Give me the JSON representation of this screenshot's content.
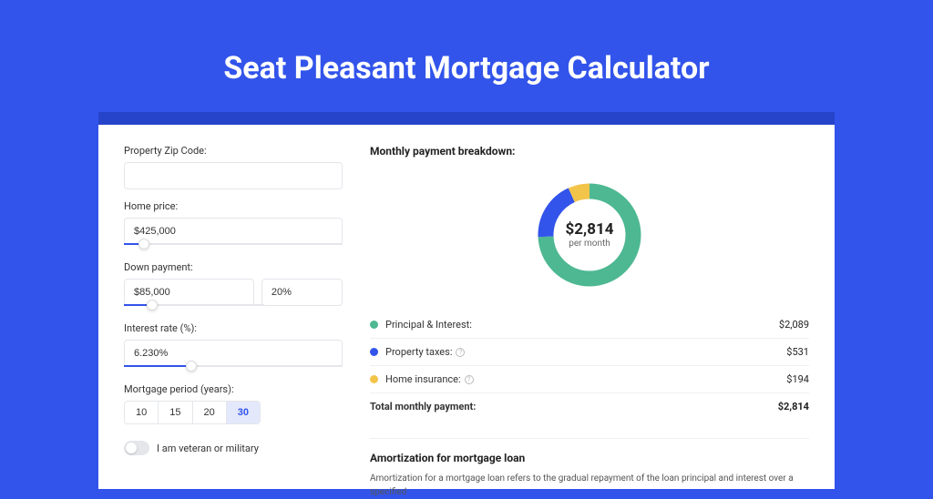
{
  "title": "Seat Pleasant Mortgage Calculator",
  "form": {
    "zip_label": "Property Zip Code:",
    "zip_value": "",
    "price_label": "Home price:",
    "price_value": "$425,000",
    "price_slider_pct": 9,
    "dp_label": "Down payment:",
    "dp_value": "$85,000",
    "dp_pct_value": "20%",
    "dp_slider_pct": 20,
    "rate_label": "Interest rate (%):",
    "rate_value": "6.230%",
    "rate_slider_pct": 31,
    "period_label": "Mortgage period (years):",
    "periods": [
      "10",
      "15",
      "20",
      "30"
    ],
    "period_active": "30",
    "vet_label": "I am veteran or military"
  },
  "breakdown": {
    "title": "Monthly payment breakdown:",
    "total": "$2,814",
    "sub": "per month",
    "items": [
      {
        "label": "Principal & Interest:",
        "value": "$2,089",
        "color": "#4db892",
        "has_info": false
      },
      {
        "label": "Property taxes:",
        "value": "$531",
        "color": "#3254eb",
        "has_info": true
      },
      {
        "label": "Home insurance:",
        "value": "$194",
        "color": "#f2c44a",
        "has_info": true
      }
    ],
    "total_label": "Total monthly payment:",
    "total_value": "$2,814"
  },
  "chart_data": {
    "type": "pie",
    "title": "Monthly payment breakdown",
    "series": [
      {
        "name": "Principal & Interest",
        "value": 2089,
        "color": "#4db892"
      },
      {
        "name": "Property taxes",
        "value": 531,
        "color": "#3254eb"
      },
      {
        "name": "Home insurance",
        "value": 194,
        "color": "#f2c44a"
      }
    ],
    "total": 2814,
    "center_label": "$2,814",
    "center_sub": "per month"
  },
  "amort": {
    "title": "Amortization for mortgage loan",
    "text": "Amortization for a mortgage loan refers to the gradual repayment of the loan principal and interest over a specified"
  }
}
